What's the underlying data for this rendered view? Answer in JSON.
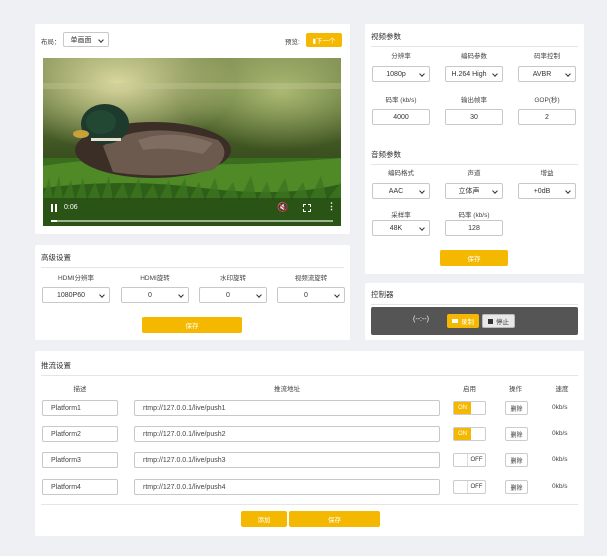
{
  "preview": {
    "layout_label": "布局：",
    "layout_value": "单画面",
    "preview_label": "预览:",
    "next_btn": "▮下一个",
    "video_time": "0:06",
    "progress": 0.02
  },
  "advanced": {
    "title": "高级设置",
    "cols": [
      {
        "label": "HDMI分辨率",
        "value": "1080P60"
      },
      {
        "label": "HDMI旋转",
        "value": "0"
      },
      {
        "label": "水印旋转",
        "value": "0"
      },
      {
        "label": "视频流旋转",
        "value": "0"
      }
    ],
    "save": "保存"
  },
  "video_params": {
    "title": "视频参数",
    "row1": [
      {
        "label": "分辨率",
        "value": "1080p"
      },
      {
        "label": "编码参数",
        "value": "H.264 High"
      },
      {
        "label": "码率控制",
        "value": "AVBR"
      }
    ],
    "row2": [
      {
        "label": "码率 (kb/s)",
        "value": "4000"
      },
      {
        "label": "输出帧率",
        "value": "30"
      },
      {
        "label": "GOP(秒)",
        "value": "2"
      }
    ]
  },
  "audio_params": {
    "title": "音频参数",
    "row1": [
      {
        "label": "编码格式",
        "value": "AAC"
      },
      {
        "label": "声道",
        "value": "立体声"
      },
      {
        "label": "增益",
        "value": "+0dB"
      }
    ],
    "row2": [
      {
        "label": "采样率",
        "value": "48K"
      },
      {
        "label": "码率 (kb/s)",
        "value": "128"
      }
    ],
    "save": "保存"
  },
  "controller": {
    "title": "控制器",
    "time": "(--:--)",
    "record": "录制",
    "stop": "停止"
  },
  "streaming": {
    "title": "推流设置",
    "headers": {
      "desc": "描述",
      "url": "推流地址",
      "enable": "启用",
      "action": "操作",
      "speed": "速度"
    },
    "rows": [
      {
        "name": "Platform1",
        "url": "rtmp://127.0.0.1/live/push1",
        "toggle": "ON",
        "enabled": true,
        "del": "删除",
        "speed": "0kb/s"
      },
      {
        "name": "Platform2",
        "url": "rtmp://127.0.0.1/live/push2",
        "toggle": "ON",
        "enabled": true,
        "del": "删除",
        "speed": "0kb/s"
      },
      {
        "name": "Platform3",
        "url": "rtmp://127.0.0.1/live/push3",
        "toggle": "OFF",
        "enabled": false,
        "del": "删除",
        "speed": "0kb/s"
      },
      {
        "name": "Platform4",
        "url": "rtmp://127.0.0.1/live/push4",
        "toggle": "OFF",
        "enabled": false,
        "del": "删除",
        "speed": "0kb/s"
      }
    ],
    "add": "添加",
    "save": "保存"
  },
  "colors": {
    "accent": "#f5b800",
    "control_bar": "#555555"
  }
}
